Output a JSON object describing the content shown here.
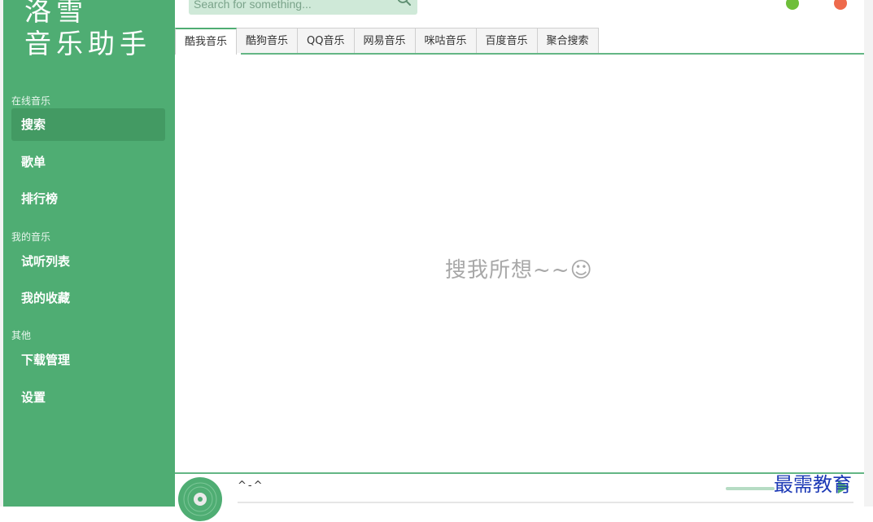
{
  "app": {
    "logo_line1": "洛雪",
    "logo_line2": "音乐助手"
  },
  "search": {
    "placeholder": "Search for something..."
  },
  "sidebar": {
    "sections": [
      {
        "label": "在线音乐",
        "items": [
          {
            "label": "搜索",
            "active": true
          },
          {
            "label": "歌单"
          },
          {
            "label": "排行榜"
          }
        ]
      },
      {
        "label": "我的音乐",
        "items": [
          {
            "label": "试听列表"
          },
          {
            "label": "我的收藏"
          }
        ]
      },
      {
        "label": "其他",
        "items": [
          {
            "label": "下载管理"
          },
          {
            "label": "设置"
          }
        ]
      }
    ]
  },
  "tabs": [
    "酷我音乐",
    "酷狗音乐",
    "QQ音乐",
    "网易音乐",
    "咪咕音乐",
    "百度音乐",
    "聚合搜索"
  ],
  "content": {
    "empty_message": "搜我所想~~☺"
  },
  "player": {
    "track_title": "^-^"
  },
  "watermark": "最需教育",
  "colors": {
    "sidebar": "#4fad73",
    "sidebar_active": "#439a63",
    "accent_line": "#64b685",
    "window_min": "#6ebe3a",
    "window_close": "#ee6a4c"
  },
  "icons": {
    "search": "search-icon",
    "disc": "disc-icon",
    "play": "play-icon"
  }
}
